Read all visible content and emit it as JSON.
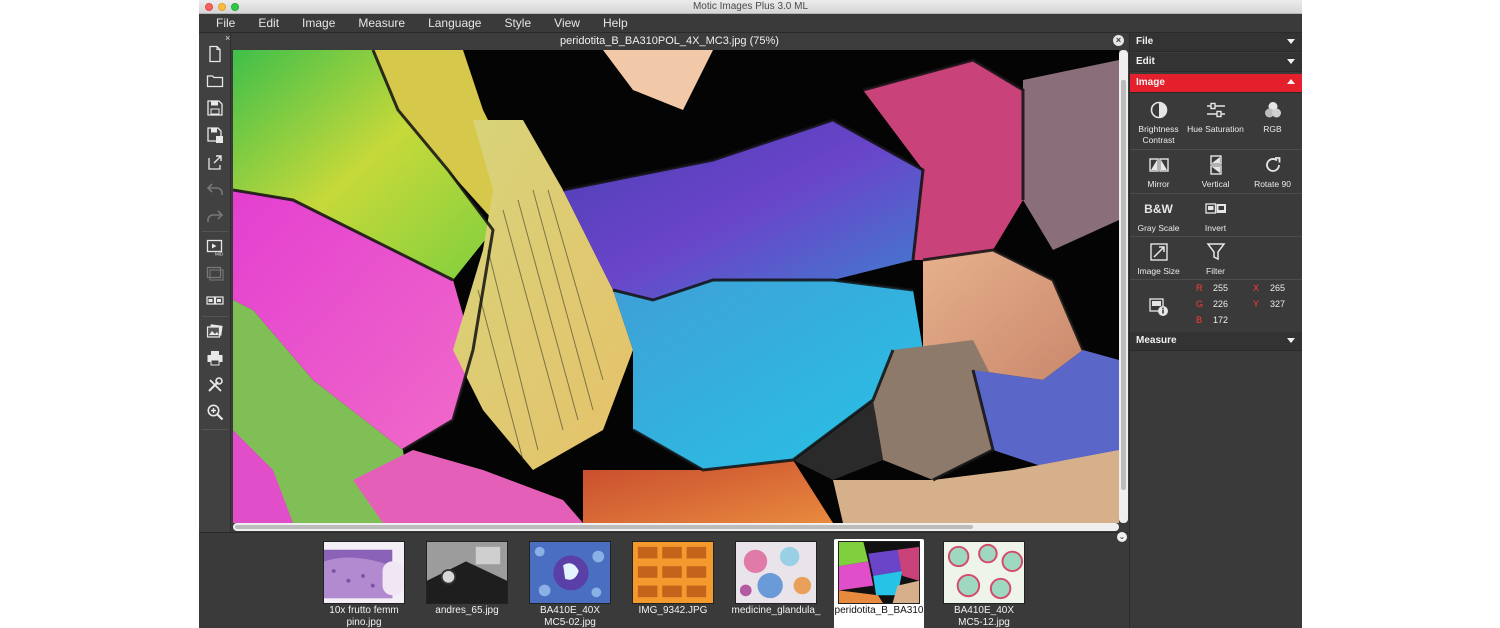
{
  "app": {
    "title": "Motic Images Plus 3.0 ML"
  },
  "window_controls": [
    "close-icon",
    "minimize-icon",
    "maximize-icon"
  ],
  "menu": [
    "File",
    "Edit",
    "Image",
    "Measure",
    "Language",
    "Style",
    "View",
    "Help"
  ],
  "toolbar": {
    "close_glyph": "×",
    "tools": [
      {
        "name": "new-document-icon",
        "enabled": true
      },
      {
        "name": "open-folder-icon",
        "enabled": true
      },
      {
        "name": "save-icon",
        "enabled": true
      },
      {
        "name": "save-as-icon",
        "enabled": true
      },
      {
        "name": "export-icon",
        "enabled": true
      },
      {
        "name": "undo-icon",
        "enabled": false
      },
      {
        "name": "redo-icon",
        "enabled": false
      },
      {
        "name": "video-play-icon",
        "enabled": true
      },
      {
        "name": "capture-icon",
        "enabled": false
      },
      {
        "name": "compare-icon",
        "enabled": true
      },
      {
        "name": "gallery-icon",
        "enabled": true
      },
      {
        "name": "print-icon",
        "enabled": true
      },
      {
        "name": "tools-icon",
        "enabled": true
      },
      {
        "name": "zoom-icon",
        "enabled": true
      }
    ]
  },
  "document": {
    "title": "peridotita_B_BA310POL_4X_MC3.jpg (75%)",
    "close_glyph": "×"
  },
  "filmstrip": {
    "scroll_glyph": "⌄",
    "items": [
      {
        "label1": "10x frutto femm",
        "label2": "pino.jpg",
        "selected": false
      },
      {
        "label1": "andres_65.jpg",
        "label2": "",
        "selected": false
      },
      {
        "label1": "BA410E_40X",
        "label2": "MC5-02.jpg",
        "selected": false
      },
      {
        "label1": "IMG_9342.JPG",
        "label2": "",
        "selected": false
      },
      {
        "label1": "medicine_glandula_",
        "label2": "",
        "selected": false
      },
      {
        "label1": "peridotita_B_BA310",
        "label2": "",
        "selected": true
      },
      {
        "label1": "BA410E_40X",
        "label2": "MC5-12.jpg",
        "selected": false
      }
    ]
  },
  "panel": {
    "sections": {
      "file": "File",
      "edit": "Edit",
      "image": "Image",
      "measure": "Measure"
    },
    "image_tools": {
      "brightness_contrast": [
        "Brightness",
        "Contrast"
      ],
      "hue_saturation": "Hue Saturation",
      "rgb": "RGB",
      "mirror": "Mirror",
      "vertical": "Vertical",
      "rotate": "Rotate 90",
      "grayscale_icon_text": "B&W",
      "grayscale": "Gray Scale",
      "invert": "Invert",
      "image_size": "Image Size",
      "filter": "Filter"
    },
    "pixel_info": {
      "r_label": "R",
      "r_value": "255",
      "g_label": "G",
      "g_value": "226",
      "b_label": "B",
      "b_value": "172",
      "x_label": "X",
      "x_value": "265",
      "y_label": "Y",
      "y_value": "327"
    }
  },
  "colors": {
    "accent": "#e3202c",
    "window_bg": "#3c3c3c",
    "panel_bg": "#3a3a3a"
  }
}
